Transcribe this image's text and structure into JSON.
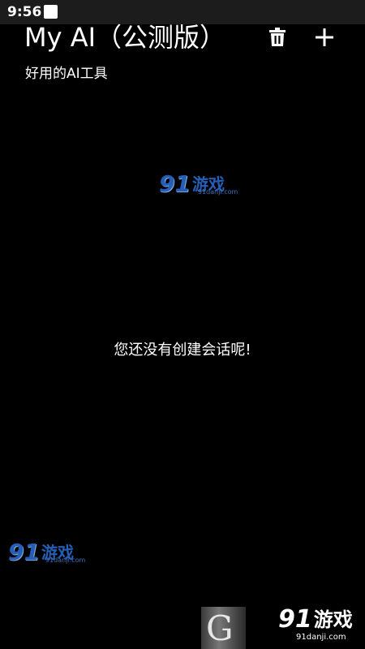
{
  "status_bar": {
    "time": "9:56"
  },
  "header": {
    "title": "My AI（公测版）",
    "subtitle": "好用的AI工具",
    "delete_icon": "trash-icon",
    "add_icon": "plus-icon"
  },
  "main": {
    "empty_message": "您还没有创建会话呢!"
  },
  "watermark": {
    "logo": "91",
    "text": "游戏",
    "url": "91danji.com"
  },
  "colors": {
    "background": "#000000",
    "text": "#ffffff",
    "status_bar": "#1c1c1c",
    "watermark": "#2b6fd6"
  }
}
